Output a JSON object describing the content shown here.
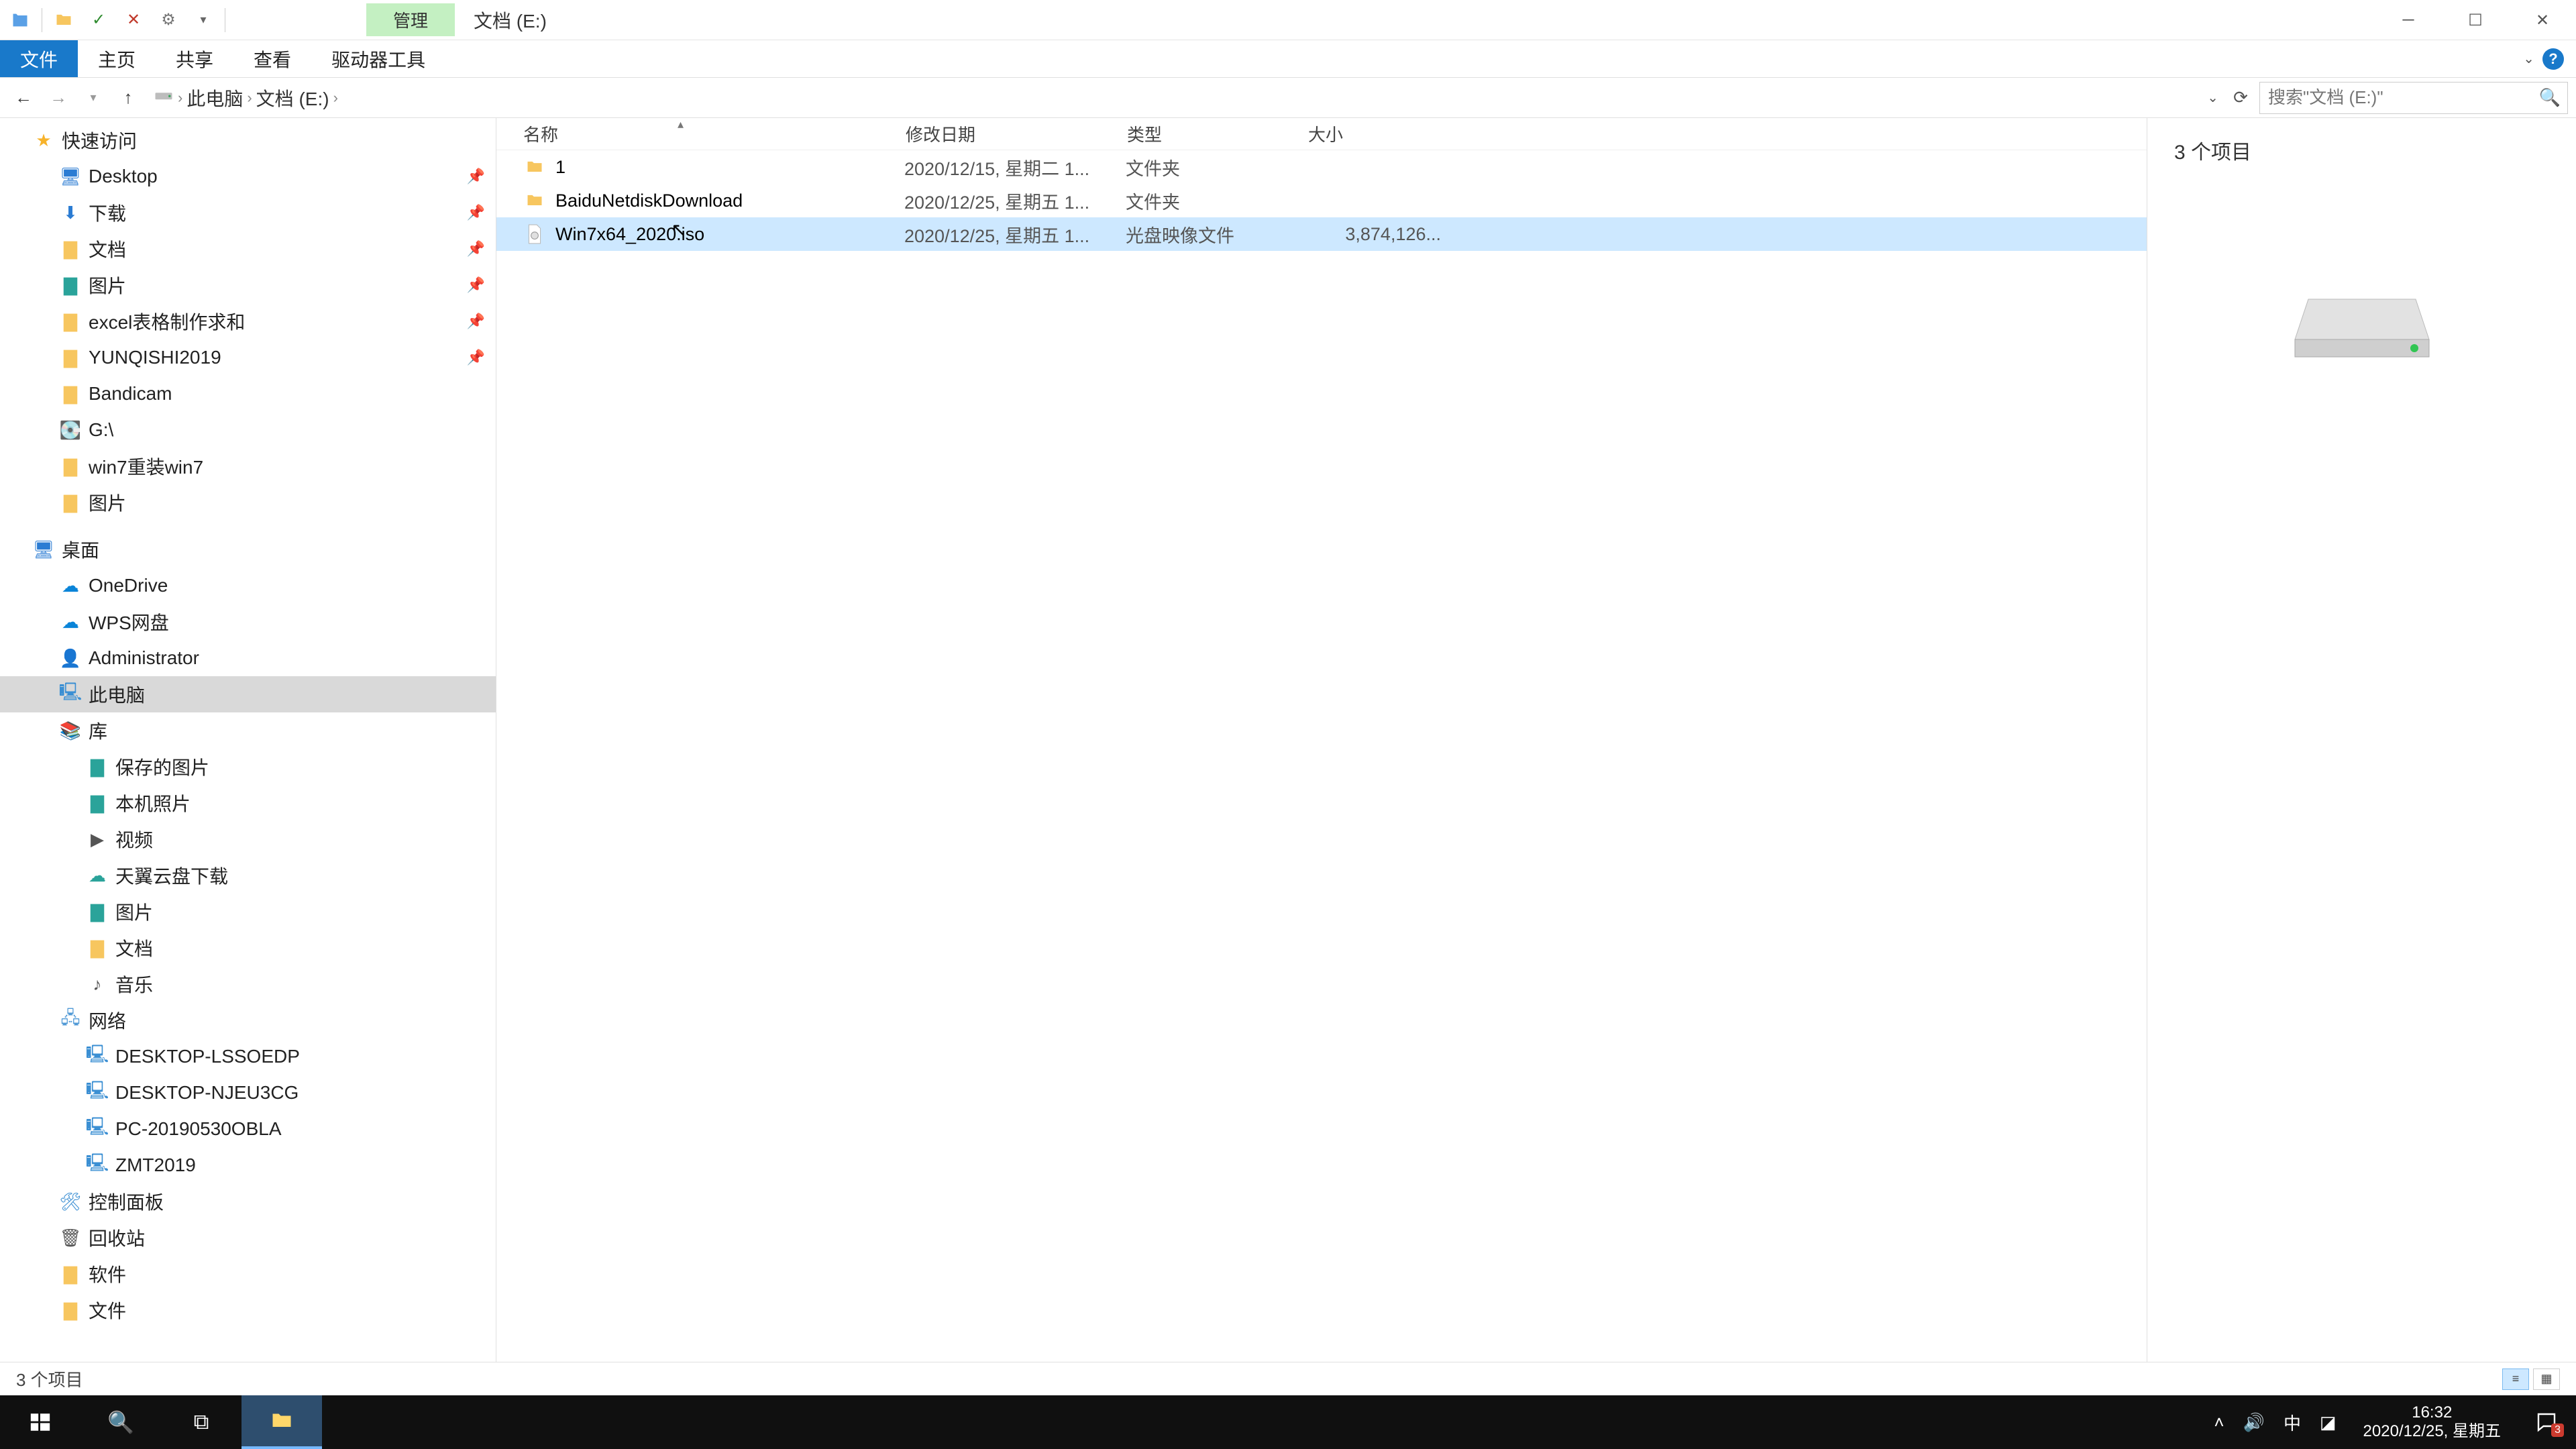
{
  "title": {
    "context_tab": "管理",
    "window_title": "文档 (E:)"
  },
  "ribbon": {
    "file": "文件",
    "home": "主页",
    "share": "共享",
    "view": "查看",
    "drive_tools": "驱动器工具"
  },
  "addr": {
    "crumb_pc": "此电脑",
    "crumb_drive": "文档 (E:)",
    "search_placeholder": "搜索\"文档 (E:)\""
  },
  "sidebar": {
    "quick_access": "快速访问",
    "desktop": "Desktop",
    "downloads": "下载",
    "documents": "文档",
    "pictures": "图片",
    "excel_req": "excel表格制作求和",
    "yunqishi": "YUNQISHI2019",
    "bandicam": "Bandicam",
    "gdrive": "G:\\",
    "win7reinstall": "win7重装win7",
    "pictures2": "图片",
    "desktop_cn": "桌面",
    "onedrive": "OneDrive",
    "wps": "WPS网盘",
    "admin": "Administrator",
    "this_pc": "此电脑",
    "libraries": "库",
    "saved_pictures": "保存的图片",
    "camera_roll": "本机照片",
    "videos": "视频",
    "tianyi": "天翼云盘下载",
    "pictures3": "图片",
    "documents2": "文档",
    "music": "音乐",
    "network": "网络",
    "pc1": "DESKTOP-LSSOEDP",
    "pc2": "DESKTOP-NJEU3CG",
    "pc3": "PC-20190530OBLA",
    "pc4": "ZMT2019",
    "control_panel": "控制面板",
    "recycle_bin": "回收站",
    "software": "软件",
    "files": "文件"
  },
  "columns": {
    "name": "名称",
    "date": "修改日期",
    "type": "类型",
    "size": "大小"
  },
  "files": [
    {
      "name": "1",
      "date": "2020/12/15, 星期二 1...",
      "type": "文件夹",
      "size": "",
      "kind": "folder"
    },
    {
      "name": "BaiduNetdiskDownload",
      "date": "2020/12/25, 星期五 1...",
      "type": "文件夹",
      "size": "",
      "kind": "folder"
    },
    {
      "name": "Win7x64_2020.iso",
      "date": "2020/12/25, 星期五 1...",
      "type": "光盘映像文件",
      "size": "3,874,126...",
      "kind": "iso",
      "selected": true
    }
  ],
  "preview": {
    "item_count_label": "3 个项目"
  },
  "status": {
    "item_count": "3 个项目"
  },
  "clock": {
    "time": "16:32",
    "date": "2020/12/25, 星期五"
  },
  "tray": {
    "ime": "中",
    "noti_badge": "3"
  }
}
